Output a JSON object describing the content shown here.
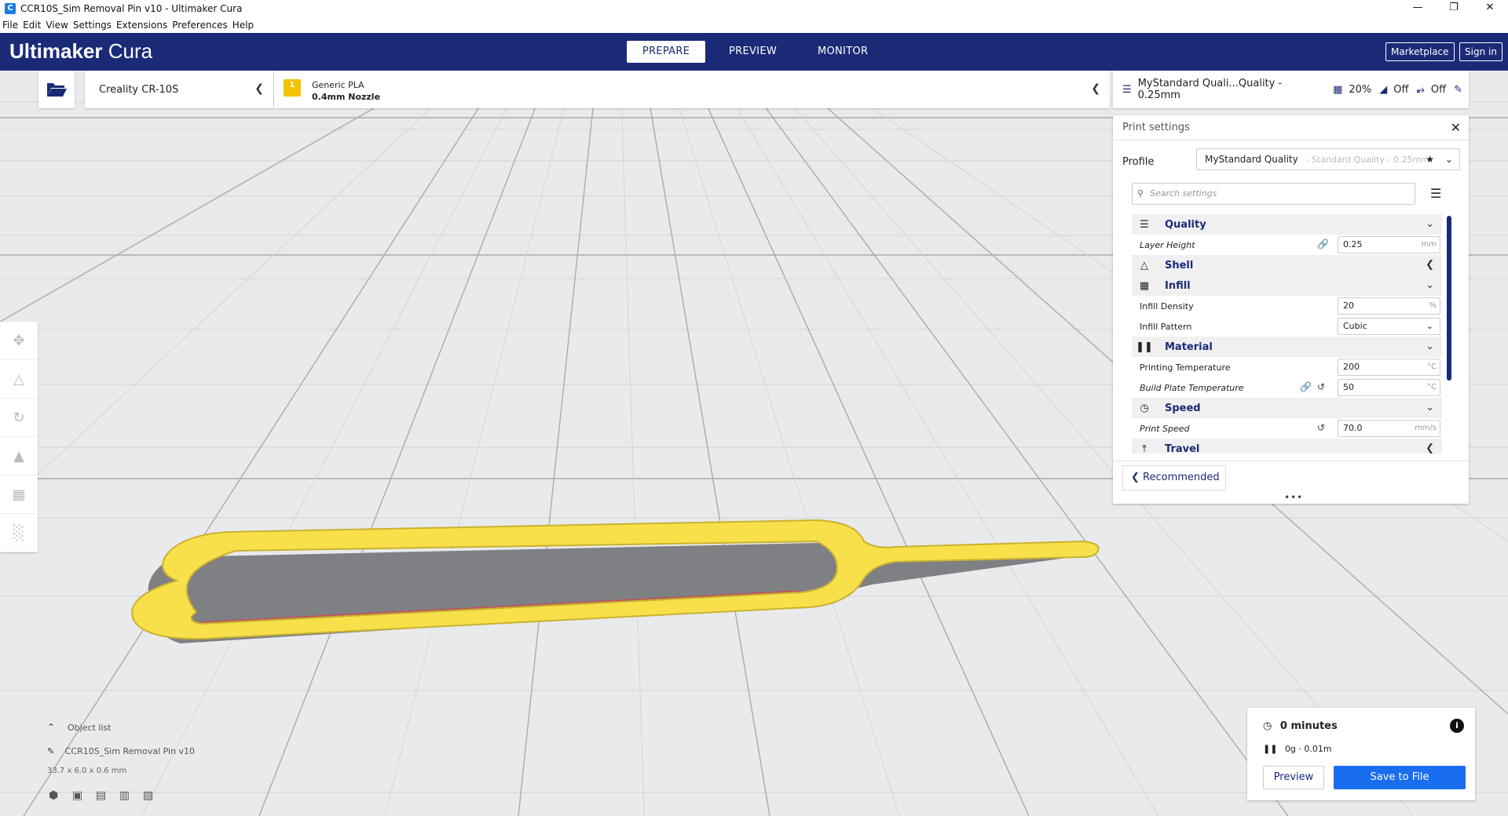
{
  "window": {
    "title": "CCR10S_Sim Removal Pin v10 - Ultimaker Cura",
    "app_icon": "C",
    "minimize": "—",
    "maximize": "❐",
    "close": "✕"
  },
  "menu": [
    "File",
    "Edit",
    "View",
    "Settings",
    "Extensions",
    "Preferences",
    "Help"
  ],
  "header": {
    "logo_bold": "Ultimaker",
    "logo_light": "Cura",
    "tabs": [
      "PREPARE",
      "PREVIEW",
      "MONITOR"
    ],
    "marketplace": "Marketplace",
    "signin": "Sign in"
  },
  "printer": {
    "name": "Creality CR-10S"
  },
  "material": {
    "badge": "1",
    "name": "Generic PLA",
    "nozzle": "0.4mm Nozzle"
  },
  "quality_bar": {
    "profile": "MyStandard Quali...Quality - 0.25mm",
    "infill": "20%",
    "support": "Off",
    "adhesion": "Off"
  },
  "print_settings": {
    "title": "Print settings",
    "profile_label": "Profile",
    "profile_value": "MyStandard Quality",
    "profile_sub": "- Standard Quality - 0.25mm",
    "search_placeholder": "Search settings",
    "categories": {
      "quality": "Quality",
      "shell": "Shell",
      "infill": "Infill",
      "material": "Material",
      "speed": "Speed",
      "travel": "Travel"
    },
    "layer_height": {
      "label": "Layer Height",
      "value": "0.25",
      "unit": "mm"
    },
    "infill_density": {
      "label": "Infill Density",
      "value": "20",
      "unit": "%"
    },
    "infill_pattern": {
      "label": "Infill Pattern",
      "value": "Cubic"
    },
    "printing_temp": {
      "label": "Printing Temperature",
      "value": "200",
      "unit": "°C"
    },
    "bed_temp": {
      "label": "Build Plate Temperature",
      "value": "50",
      "unit": "°C"
    },
    "print_speed": {
      "label": "Print Speed",
      "value": "70.0",
      "unit": "mm/s"
    },
    "recommended": "Recommended"
  },
  "object": {
    "list_label": "Object list",
    "name": "CCR10S_Sim Removal Pin v10",
    "dims": "33.7 x 6.0 x 0.6 mm"
  },
  "output": {
    "time": "0 minutes",
    "material": "0g · 0.01m",
    "preview": "Preview",
    "save": "Save to File"
  },
  "colors": {
    "header": "#1b2a77",
    "accent": "#196ef0",
    "model": "#f7e04a",
    "plate": "#e9eaec"
  }
}
